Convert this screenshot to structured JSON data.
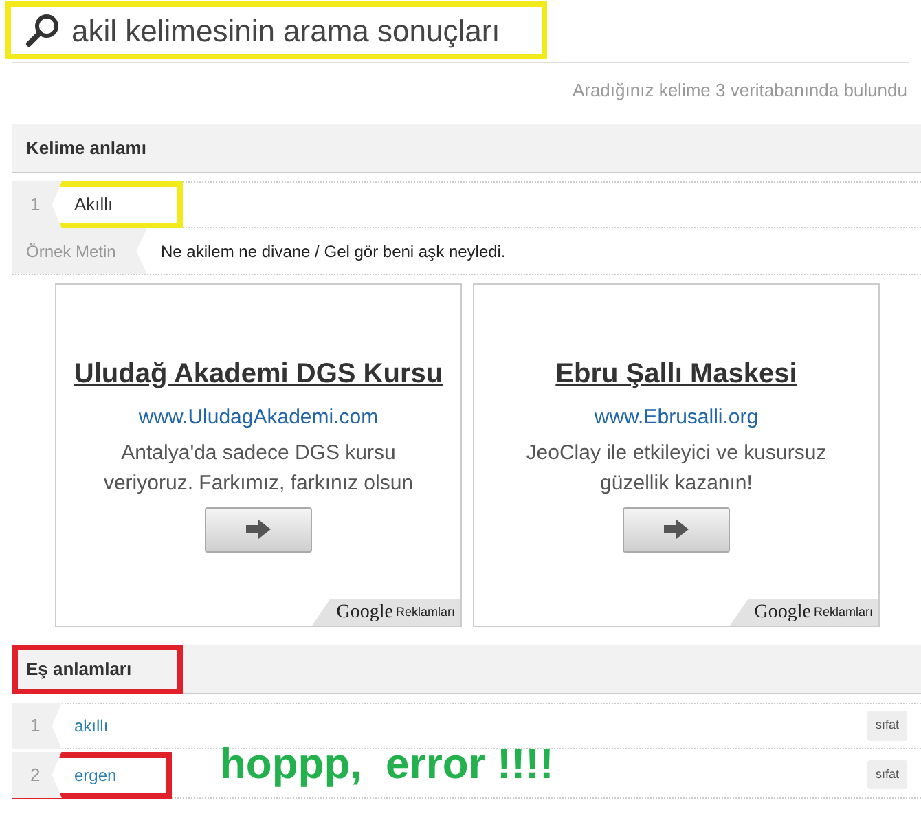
{
  "title": {
    "text": "akil kelimesinin arama sonuçları",
    "color": "#f2ea1a"
  },
  "summary": "Aradığınız kelime 3 veritabanında bulundu",
  "sections": [
    {
      "heading": "Kelime anlamı",
      "kind": "meanings",
      "items": [
        {
          "number": "1",
          "text": "Akıllı",
          "color": "#f2ea1a",
          "example_label": "Örnek Metin",
          "example": "Ne akilem ne divane / Gel gör beni aşk neyledi."
        }
      ],
      "ads": [
        {
          "title": "Uludağ Akademi DGS Kursu",
          "url": "www.UludagAkademi.com",
          "text": "Antalya'da sadece DGS kursu veriyoruz. Farkımız, farkınız olsun",
          "brand": "Google",
          "brand_suffix": "Reklamları"
        },
        {
          "title": "Ebru Şallı Maskesi",
          "url": "www.Ebrusalli.org",
          "text": "JeoClay ile etkileyici ve kusursuz güzellik kazanın!",
          "brand": "Google",
          "brand_suffix": "Reklamları"
        }
      ]
    },
    {
      "heading": "Eş anlamları",
      "color": "#e0202a",
      "kind": "synonyms",
      "items": [
        {
          "number": "1",
          "text": "akıllı",
          "tag": "sıfat"
        },
        {
          "number": "2",
          "text": "ergen",
          "tag": "sıfat",
          "color": "#e0202a"
        }
      ]
    }
  ],
  "annotation_note": "hoppp,  error !!!!"
}
